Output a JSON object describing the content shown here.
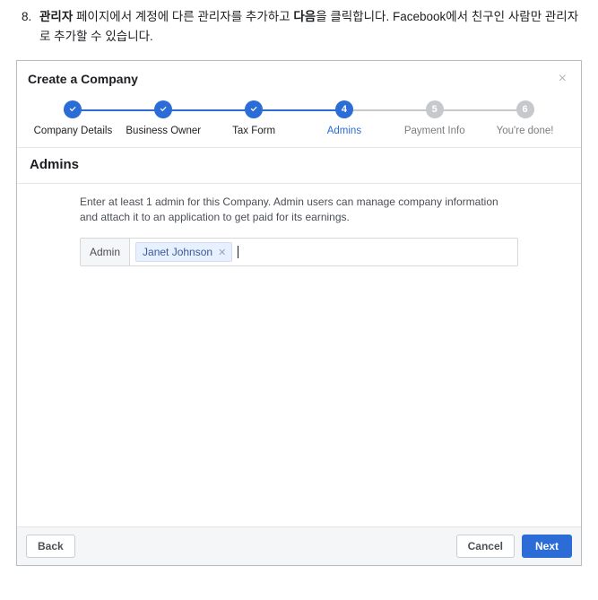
{
  "instruction": {
    "number": "8.",
    "lead_bold": "관리자",
    "part1": " 페이지에서 계정에 다른 관리자를 추가하고 ",
    "mid_bold": "다음",
    "part2": "을 클릭합니다. Facebook에서 친구인 사람만 관리자로 추가할 수 있습니다."
  },
  "dialog": {
    "title": "Create a Company",
    "steps": [
      {
        "label": "Company Details",
        "state": "done"
      },
      {
        "label": "Business Owner",
        "state": "done"
      },
      {
        "label": "Tax Form",
        "state": "done"
      },
      {
        "label": "Admins",
        "state": "current",
        "num": "4"
      },
      {
        "label": "Payment Info",
        "state": "todo",
        "num": "5"
      },
      {
        "label": "You're done!",
        "state": "todo",
        "num": "6"
      }
    ],
    "section_title": "Admins",
    "help_text": "Enter at least 1 admin for this Company. Admin users can manage company information and attach it to an application to get paid for its earnings.",
    "admin_field": {
      "label": "Admin",
      "chips": [
        "Janet Johnson"
      ]
    },
    "footer": {
      "back": "Back",
      "cancel": "Cancel",
      "next": "Next"
    }
  }
}
